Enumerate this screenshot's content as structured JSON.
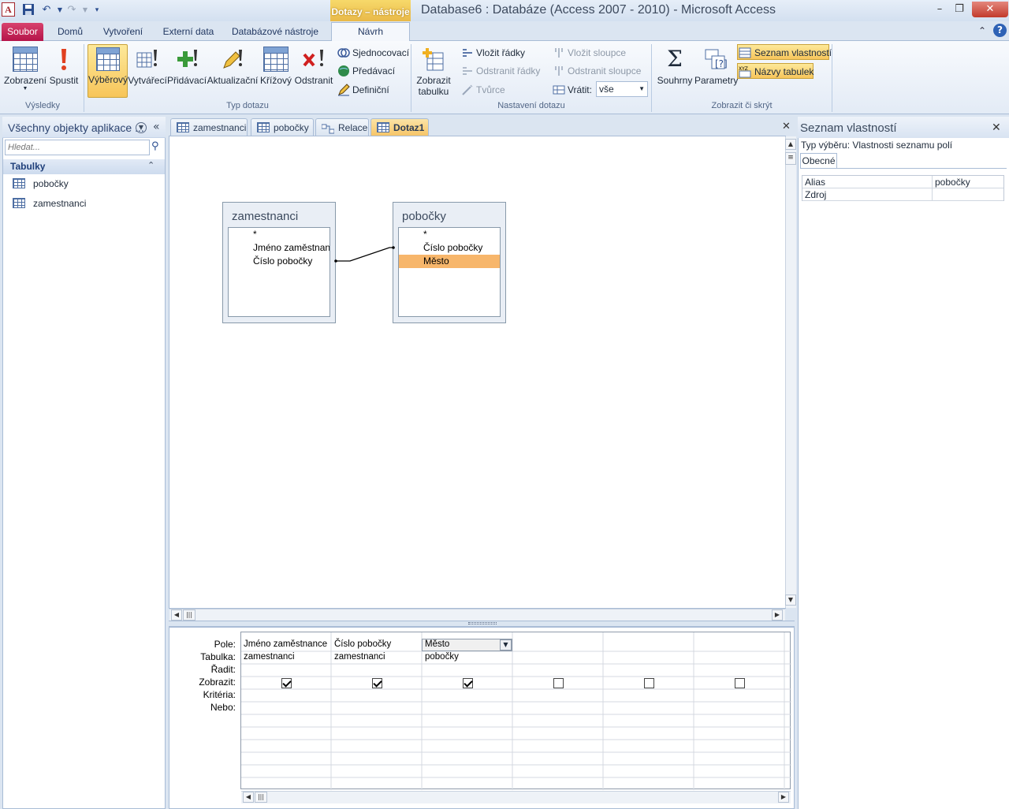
{
  "titlebar": {
    "app_icon_letter": "A",
    "context_tab": "Dotazy – nástroje",
    "title": "Database6 : Databáze (Access 2007 - 2010)  -  Microsoft Access",
    "minimize_glyph": "–",
    "restore_glyph": "❐",
    "close_glyph": "✕"
  },
  "ribbon_tabs": [
    "Soubor",
    "Domů",
    "Vytvoření",
    "Externí data",
    "Databázové nástroje",
    "Návrh"
  ],
  "ribbon": {
    "groups": {
      "vysledky": "Výsledky",
      "typ_dotazu": "Typ dotazu",
      "nastaveni": "Nastavení dotazu",
      "zobrazit": "Zobrazit či skrýt"
    },
    "buttons": {
      "zobrazeni": "Zobrazení",
      "spustit": "Spustit",
      "vyberovy": "Výběrový",
      "vytvareci": "Vytvářecí",
      "pridavaci": "Přidávací",
      "aktualizacni": "Aktualizační",
      "krizovy": "Křížový",
      "odstranit": "Odstranit",
      "sjednocovaci": "Sjednocovací",
      "predavaci": "Předávací",
      "definicni": "Definiční",
      "zobrazit_tabulku_1": "Zobrazit",
      "zobrazit_tabulku_2": "tabulku",
      "vlozit_radky": "Vložit řádky",
      "odstranit_radky": "Odstranit řádky",
      "tvurce": "Tvůrce",
      "vlozit_sloupce": "Vložit sloupce",
      "odstranit_sloupce": "Odstranit sloupce",
      "vratit_label": "Vrátit:",
      "vratit_value": "vše",
      "souhrny": "Souhrny",
      "parametry": "Parametry",
      "seznam_vlastnosti": "Seznam vlastností",
      "nazvy_tabulek": "Názvy tabulek"
    }
  },
  "nav": {
    "title": "Všechny objekty aplikace ...",
    "search_placeholder": "Hledat...",
    "group": "Tabulky",
    "items": [
      "pobočky",
      "zamestnanci"
    ]
  },
  "doc_tabs": [
    "zamestnanci",
    "pobočky",
    "Relace",
    "Dotaz1"
  ],
  "design": {
    "tables": [
      {
        "name": "zamestnanci",
        "fields": [
          "*",
          "Jméno zaměstnance",
          "Číslo pobočky"
        ]
      },
      {
        "name": "pobočky",
        "fields": [
          "*",
          "Číslo pobočky",
          "Město"
        ],
        "selected": "Město"
      }
    ]
  },
  "qbe": {
    "row_labels": [
      "Pole:",
      "Tabulka:",
      "Řadit:",
      "Zobrazit:",
      "Kritéria:",
      "Nebo:"
    ],
    "columns": [
      {
        "field": "Jméno zaměstnance",
        "table": "zamestnanci",
        "show": true
      },
      {
        "field": "Číslo pobočky",
        "table": "zamestnanci",
        "show": true
      },
      {
        "field": "Město",
        "table": "pobočky",
        "show": true
      },
      {
        "field": "",
        "table": "",
        "show": false
      },
      {
        "field": "",
        "table": "",
        "show": false
      },
      {
        "field": "",
        "table": "",
        "show": false
      }
    ]
  },
  "props": {
    "title": "Seznam vlastností",
    "selection_type": "Typ výběru:  Vlastnosti seznamu polí",
    "tab": "Obecné",
    "rows": [
      {
        "name": "Alias",
        "value": "pobočky"
      },
      {
        "name": "Zdroj",
        "value": ""
      }
    ]
  }
}
